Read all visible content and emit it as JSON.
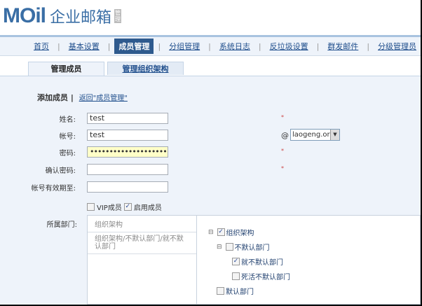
{
  "logo": {
    "brand": "MOil",
    "product": "企业邮箱",
    "badge": "管理"
  },
  "nav": [
    "首页",
    "基本设置",
    "成员管理",
    "分组管理",
    "系统日志",
    "反垃圾设置",
    "群发邮件",
    "分级管理员"
  ],
  "nav_active": "成员管理",
  "tabs": [
    "管理成员",
    "管理组织架构"
  ],
  "page": {
    "title": "添加成员",
    "back_link": "返回\"成员管理\""
  },
  "form": {
    "name_label": "姓名:",
    "name_value": "test",
    "account_label": "帐号:",
    "account_value": "test",
    "password_label": "密码:",
    "password_value": "•••••••••••••••••••••",
    "confirm_label": "确认密码:",
    "confirm_value": "",
    "expire_label": "帐号有效期至:",
    "expire_value": "",
    "required": "*",
    "at": "@",
    "domain": "laogeng.org",
    "vip_label": "VIP成员",
    "enable_label": "启用成员",
    "dept_label": "所属部门:"
  },
  "dept_selected": [
    "组织架构",
    "组织架构/不默认部门/就不默认部门"
  ],
  "tree": {
    "root": "组织架构",
    "child1": "不默认部门",
    "leaf1": "就不默认部门",
    "leaf2": "死活不默认部门",
    "child2": "默认部门"
  }
}
